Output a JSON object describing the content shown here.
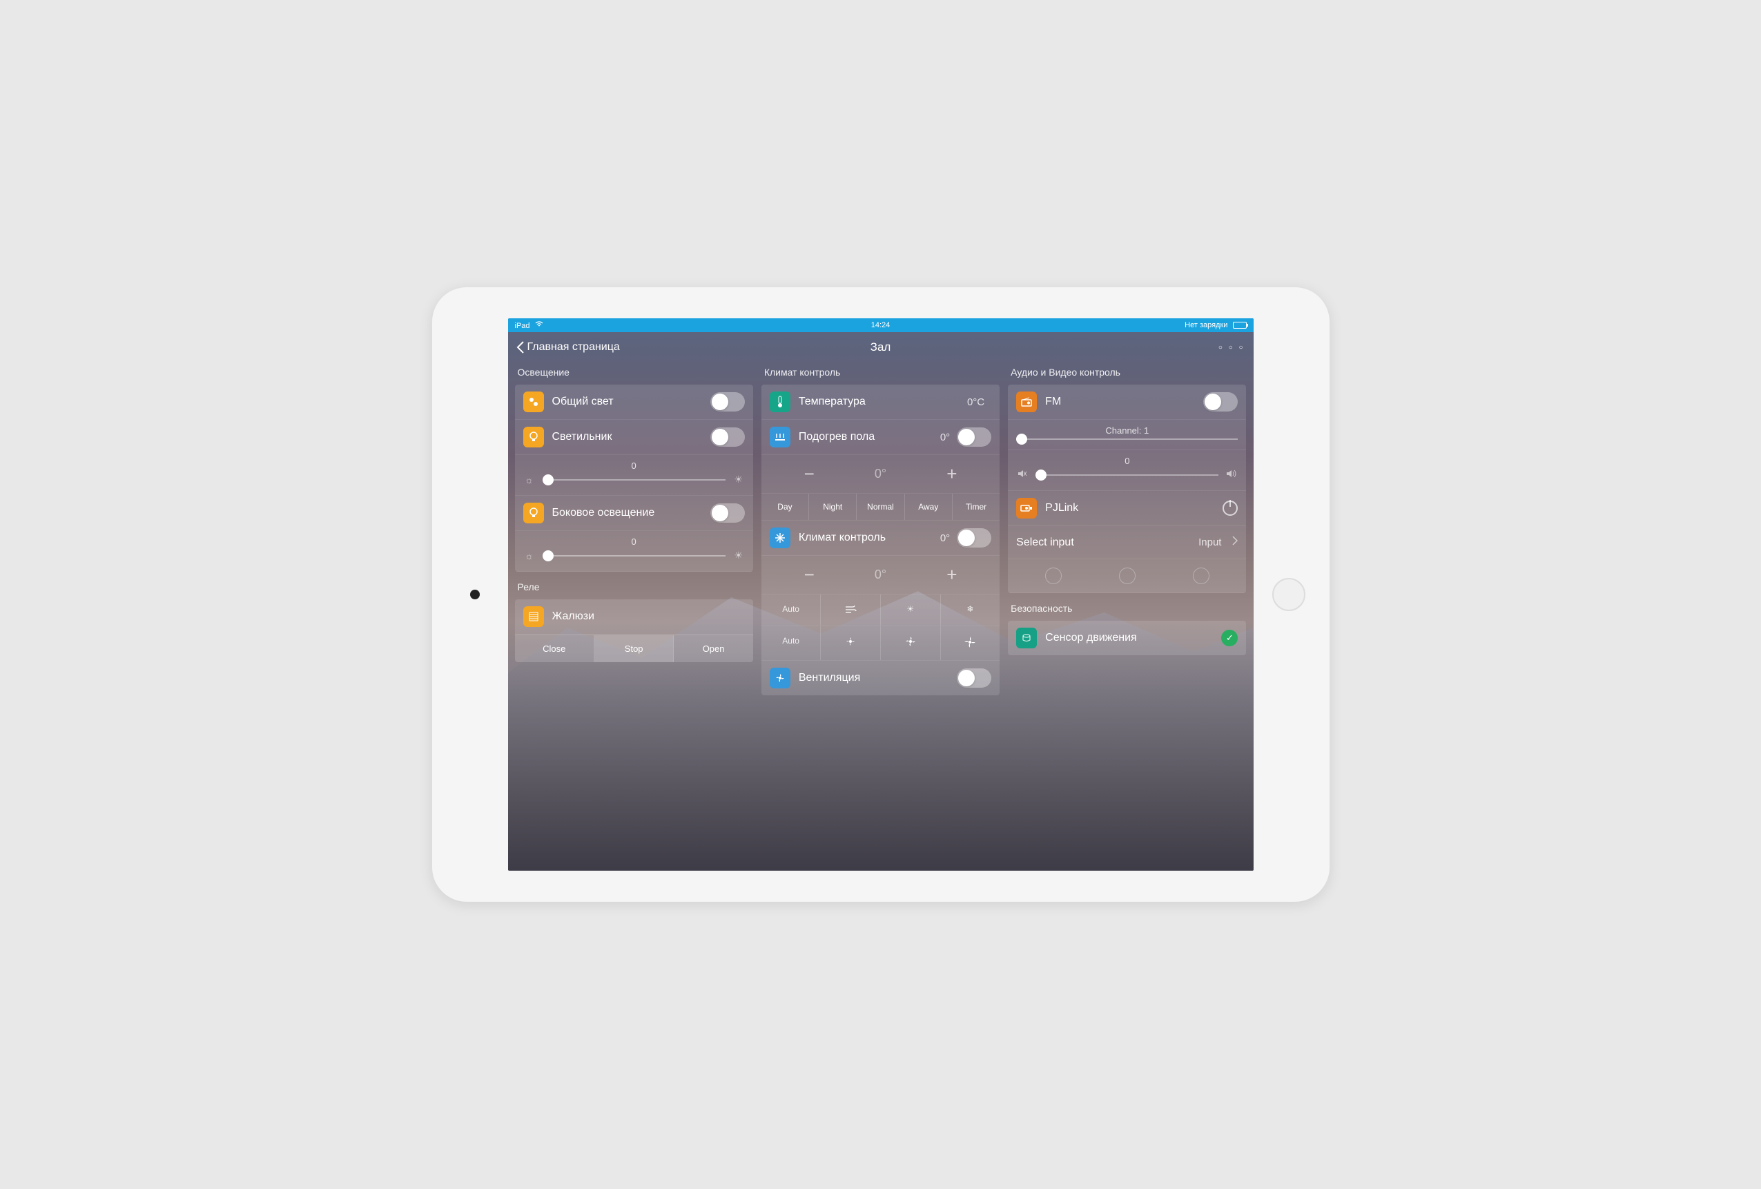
{
  "statusbar": {
    "device": "iPad",
    "time": "14:24",
    "battery_text": "Нет зарядки"
  },
  "nav": {
    "back": "Главная страница",
    "title": "Зал",
    "more": "○ ○ ○"
  },
  "col1": {
    "title": "Освещение",
    "general": "Общий свет",
    "lamp": "Светильник",
    "lamp_slider": "0",
    "side": "Боковое освещение",
    "side_slider": "0",
    "relay_title": "Реле",
    "blinds": "Жалюзи",
    "close": "Close",
    "stop": "Stop",
    "open": "Open"
  },
  "col2": {
    "title": "Климат контроль",
    "temp": "Температура",
    "temp_val": "0°C",
    "floor": "Подогрев пола",
    "floor_val": "0°",
    "floor_set": "0°",
    "mode_day": "Day",
    "mode_night": "Night",
    "mode_normal": "Normal",
    "mode_away": "Away",
    "mode_timer": "Timer",
    "climate": "Климат контроль",
    "climate_val": "0°",
    "climate_set": "0°",
    "auto1": "Auto",
    "auto2": "Auto",
    "vent": "Вентиляция"
  },
  "col3": {
    "title": "Аудио и Видео контроль",
    "fm": "FM",
    "channel": "Channel: 1",
    "vol": "0",
    "pjlink": "PJLink",
    "select_input": "Select input",
    "input_val": "Input",
    "sec_title": "Безопасность",
    "motion": "Сенсор движения"
  }
}
